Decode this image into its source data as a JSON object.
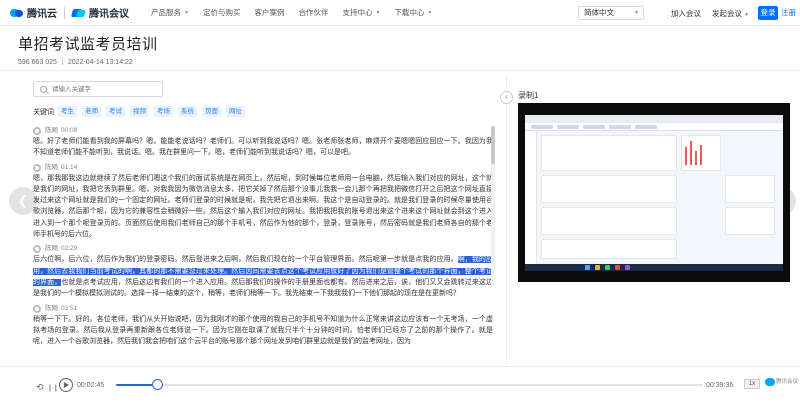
{
  "nav": {
    "brand1": "腾讯云",
    "brand2": "腾讯会议",
    "menu": [
      {
        "label": "产品服务",
        "caret": true
      },
      {
        "label": "定价与购买",
        "caret": false
      },
      {
        "label": "客户案例",
        "caret": false
      },
      {
        "label": "合作伙伴",
        "caret": false
      },
      {
        "label": "支持中心",
        "caret": true
      },
      {
        "label": "下载中心",
        "caret": true
      }
    ],
    "language": "简体中文",
    "join": "加入会议",
    "host": "发起会议",
    "login": "登录",
    "register": "注册"
  },
  "page": {
    "title": "单招考试监考员培训",
    "meta": "596 663 025 ｜ 2022-04-14 13:14:22"
  },
  "search": {
    "placeholder": "请输入关键字"
  },
  "keywords": {
    "label": "关键词",
    "items": [
      "考生",
      "老师",
      "考试",
      "视频",
      "考场",
      "系统",
      "页面",
      "网址"
    ]
  },
  "transcript": [
    {
      "speaker": "陈飏",
      "time": "00:08",
      "parts": [
        {
          "t": "嗯。好了老师们能看到我的屏幕吗？嗯。能能老说话吗？老师们。可以听到我说话吗？嗯。张老师张老师，麻烦开个麦嗯嗯回应回应一下。我因为我不知道老师们能不能听到，我说话。嗯。我在群里问一下。嗯，老师们能听到我说话吗？嗯，可以是吧。",
          "hl": false
        }
      ]
    },
    {
      "speaker": "陈飏",
      "time": "01:14",
      "parts": [
        {
          "t": "嗯，那我那我这边就继续了然后老师们嗯这个我们的面试系统是在网页上。然后呢，到时候每位老师用一台电脑，然后输入我们对应的网址，这个就是我们的网址，我把它丢到群里。嗯，对我我因为微信消息太多，把它关掉了然后那个没事儿我我一会儿那个再把我把微信打开之后把这个网址直接发过来这个网址就是我们的一个固定的网址。老师们登录的时候就是呢，我先把它退出来啊。我这个是自动登录的。就是我们登录的时候尽量使用谷歌浏览器，然后那个呢，因为它的兼容性会稍微好一些。然后这个输入我们对应的网址。我把我把我的账号退出来这个进来这个网址就会到这个进入进入到一个那个呢登录页的。页面然后使用我们老师自己的那个手机号，然后作为他的那个，登录，登录账号，然后密码就是我们老师各自的那个老师手机号的后六位。",
          "hl": false
        }
      ]
    },
    {
      "speaker": "陈飏",
      "time": "02:29",
      "parts": [
        {
          "t": "后六位啊，后六位，然后作为我们的登录密码。然后登进来之后啊，然后我们现在的一个平台管理界面。然后呢第一步就是点我的应用。",
          "hl": false
        },
        {
          "t": "啊，我的应用，然后去我我们当前考试的啊，其都的那不需要您过来处理。然后因同需要去点这个考试应用就好了因为我们是管整个考试的那个界面，整个考试的界面，",
          "hl": true
        },
        {
          "t": "也就是点考试应用，然后这边有我们的一个进入应用。然后那我们的操作的手册里面也都有。然后进来之后，诶，他们又又会跳转过来这边是我们的一个模拟模拟测试的。选择一择一结束的这个，稍等，老师们稍等一下。我先结束一下我我我们一下他们那起的现在是在更新吗？",
          "hl": false
        }
      ]
    },
    {
      "speaker": "陈飏",
      "time": "03:51",
      "parts": [
        {
          "t": "稍等一下下。好的。各位老师，我们从头开始说吧，因为我刚才的那个使用的我自己的手机号不知道为什么正常来讲这边应该有一个无考场，一个虚拟考场的登录。然后我从登录再重新跟各位老师说一下。因为它刚在取课了就我只半个十分钟的时间，怕老师们已经忘了之前的那个操作了。就是呢，进入一个谷歌浏览器，然后我们我会把咱们这个云平台的账号那个那个网址发到咱们群里边就是我们的监考网址，因为",
          "hl": false
        }
      ]
    }
  ],
  "recording": {
    "label": "录制1"
  },
  "player": {
    "current": "00:02:45",
    "total": "00:39:36",
    "progress": 0.07,
    "speed": "1x",
    "brand": "腾讯会议"
  }
}
